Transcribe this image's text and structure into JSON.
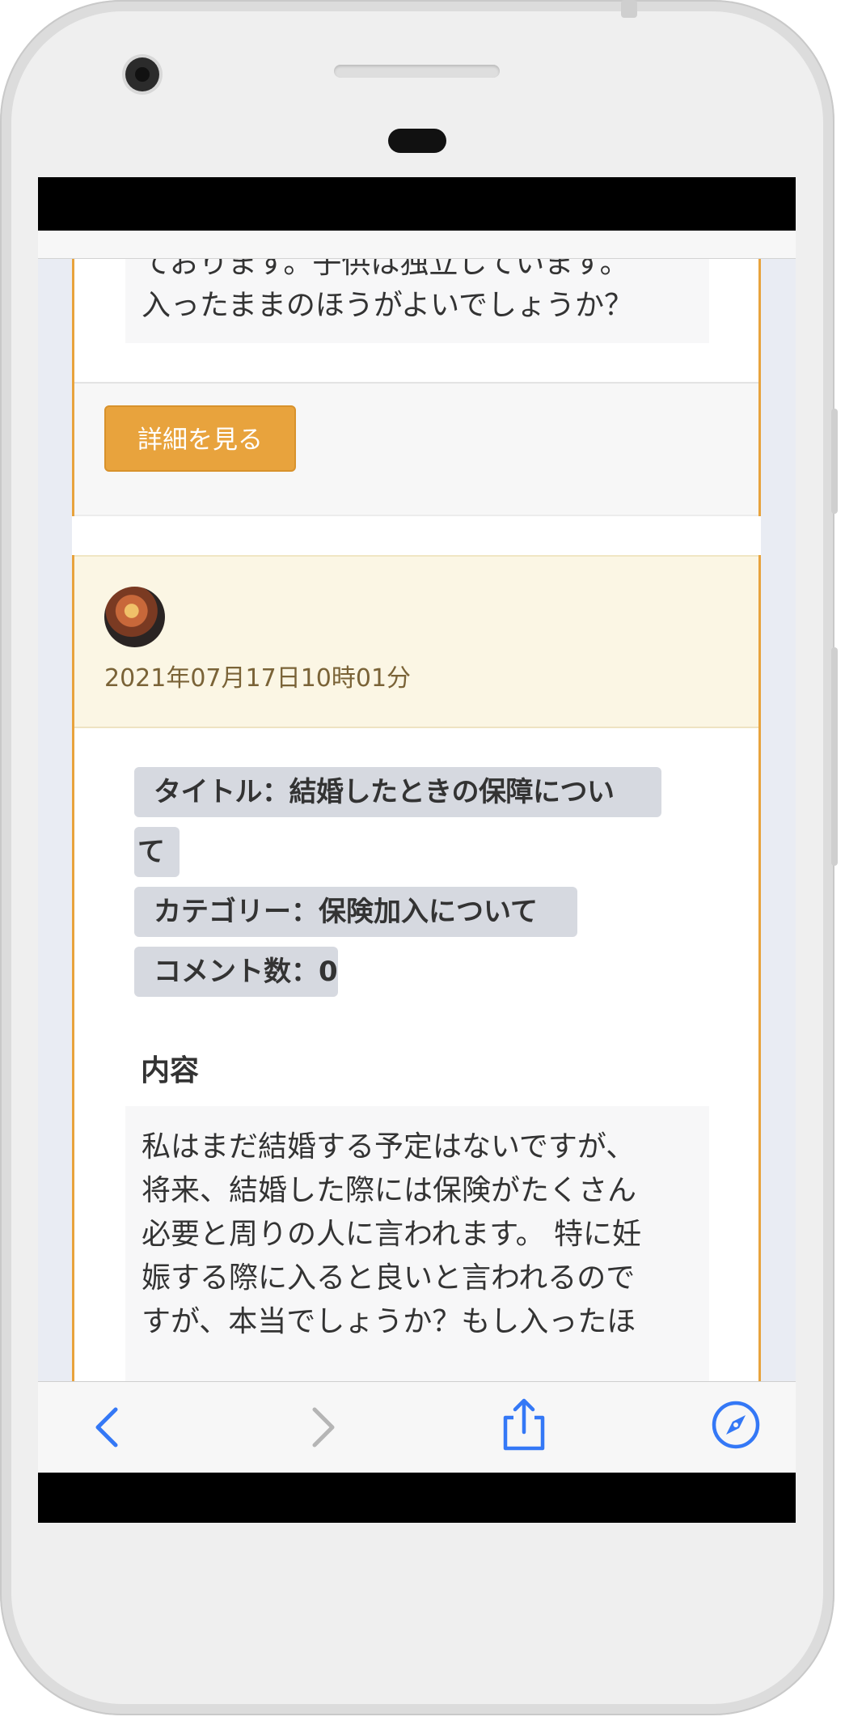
{
  "previous_post": {
    "question_text_1": "ております。子供は独立しています。",
    "question_text_2": "入ったままのほうがよいでしょうか？",
    "detail_button_label": "詳細を見る"
  },
  "post": {
    "date": "2021年07月17日10時01分",
    "title_tag_line1": "タイトル：結婚したときの保障につい",
    "title_tag_line2": "て",
    "category_tag": "カテゴリー：保険加入について",
    "comment_count_tag": "コメント数：0",
    "content_heading": "内容",
    "content_text": "私はまだ結婚する予定はないですが、\n将来、結婚した際には保険がたくさん\n必要と周りの人に言われます。 特に妊\n娠する際に入ると良いと言われるので\nすが、本当でしょうか？もし入ったほ"
  },
  "toolbar": {
    "back_icon": "chevron-left-icon",
    "forward_icon": "chevron-right-icon",
    "share_icon": "share-icon",
    "safari_icon": "compass-icon"
  },
  "colors": {
    "accent": "#e8a33d",
    "tag_bg": "#d6d9e0",
    "header_bg": "#fbf6e4",
    "ios_blue": "#3478f6"
  }
}
